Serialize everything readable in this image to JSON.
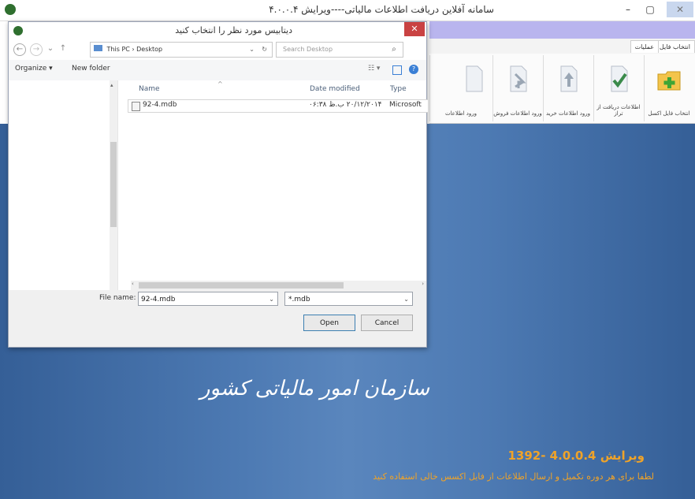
{
  "app": {
    "title": "سامانه آفلاین دریافت اطلاعات مالیاتی----ویرایش ۴.۰.۰.۴",
    "window_controls": [
      "–",
      "▢",
      "✕"
    ],
    "ribbon_tabs": [
      "انتخاب فایل",
      "عملیات"
    ],
    "ribbon_buttons": [
      {
        "label": "انتخاب فایل اکسل",
        "icon": "folder-add-icon"
      },
      {
        "label": "اطلاعات دریافت از تراز",
        "icon": "checkmark-document-icon"
      },
      {
        "label": "ورود اطلاعات خرید",
        "icon": "upload-arrow-icon"
      },
      {
        "label": "ورود اطلاعات فروش",
        "icon": "download-arrow-icon"
      },
      {
        "label": "ورود اطلاعات",
        "icon": "document-icon"
      }
    ],
    "calligraphy": "سازمان امور مالیاتی کشور",
    "version_text": "ویرایش 4.0.0.4 -1392",
    "instructions": "لطفا برای هر دوره تکمیل و ارسال اطلاعات از فایل اکسس خالی استفاده کنید",
    "colors": {
      "workspace": "#4d7ab3",
      "accent_text": "#f0a328",
      "ribbon_strip": "#b9b5ee"
    }
  },
  "dialog": {
    "title": "دیتابیس مورد نظر را انتخاب کنید",
    "close_label": "✕",
    "breadcrumb": "This PC  ›  Desktop",
    "search_placeholder": "Search Desktop",
    "toolbar": {
      "organize": "Organize ▾",
      "new_folder": "New folder"
    },
    "columns": {
      "name": "Name",
      "date": "Date modified",
      "type": "Type"
    },
    "files": [
      {
        "name": "92-4.mdb",
        "date": "۲۰/۱۲/۲۰۱۴ ب.ظ ۰۶:۳۸",
        "type": "Microsoft"
      }
    ],
    "file_name_label": "File name:",
    "file_name_value": "92-4.mdb",
    "filter_value": "*.mdb",
    "open_label": "Open",
    "cancel_label": "Cancel"
  }
}
